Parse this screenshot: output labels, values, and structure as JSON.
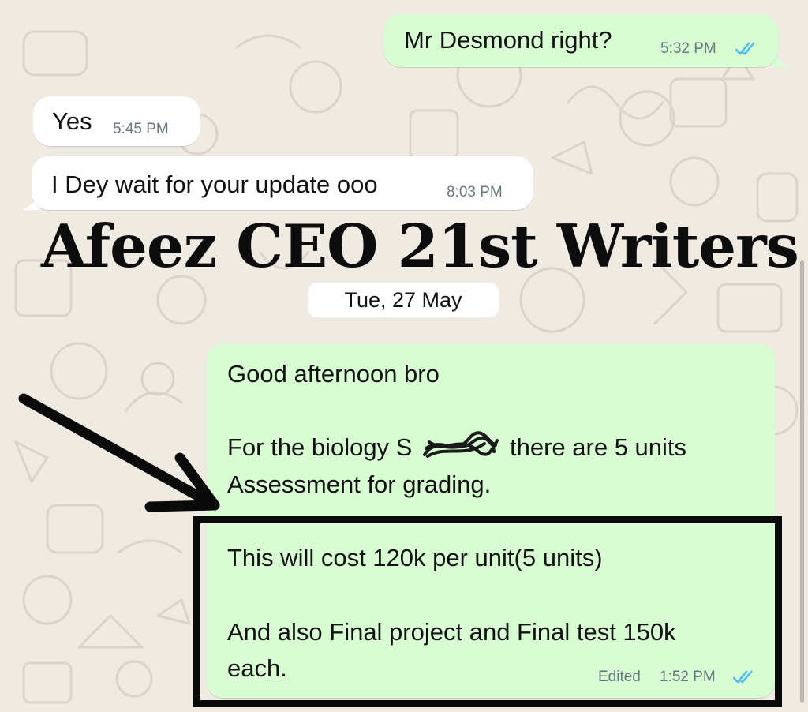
{
  "annotation_title": "Afeez CEO 21st Writers",
  "date_separator": "Tue, 27 May",
  "messages": [
    {
      "direction": "outgoing",
      "text": "Mr Desmond right?",
      "time": "5:32 PM",
      "read": true
    },
    {
      "direction": "incoming",
      "text": "Yes",
      "time": "5:45 PM"
    },
    {
      "direction": "incoming",
      "text": "I Dey wait for your update ooo",
      "time": "8:03 PM"
    },
    {
      "direction": "outgoing",
      "lines": [
        "Good afternoon bro",
        "For the biology S",
        "there are 5 units",
        "Assessment for grading.",
        "This will cost 120k per unit(5 units)",
        "And also Final project  and Final test 150k",
        "each."
      ],
      "edited_label": "Edited",
      "time": "1:52 PM",
      "read": true
    }
  ],
  "colors": {
    "outgoing_bubble": "#d9fdd3",
    "incoming_bubble": "#ffffff",
    "wallpaper": "#efeae2",
    "read_ticks": "#53bdeb",
    "timestamp": "#667781"
  },
  "icons": [
    "double-check-icon",
    "annotation-arrow-icon"
  ]
}
